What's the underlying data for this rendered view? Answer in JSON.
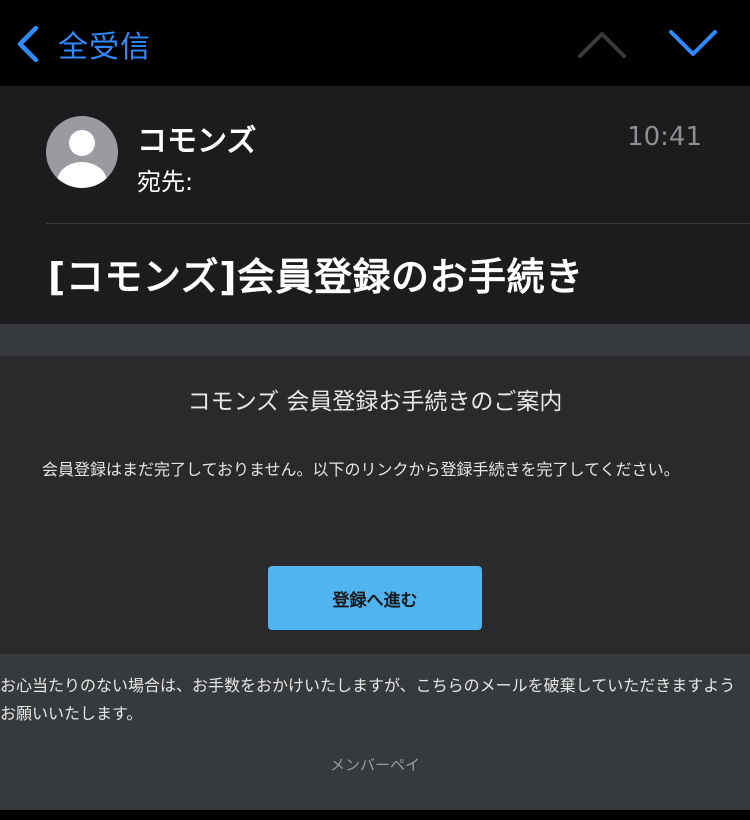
{
  "navbar": {
    "back_label": "全受信",
    "back_icon": "chevron-left-icon",
    "prev_icon": "chevron-up-icon",
    "next_icon": "chevron-down-icon",
    "accent_color": "#2f8cff",
    "disabled_color": "#3a3a3c"
  },
  "header": {
    "sender_name": "コモンズ",
    "recipient_label": "宛先:",
    "time": "10:41",
    "subject": "[コモンズ]会員登録のお手続き",
    "avatar_icon": "person-avatar-icon"
  },
  "message": {
    "card_title": "コモンズ 会員登録お手続きのご案内",
    "card_text": "会員登録はまだ完了しておりません。以下のリンクから登録手続きを完了してください。",
    "cta_label": "登録へ進む",
    "cta_color": "#4fb4f0",
    "footer_text": "お心当たりのない場合は、お手数をおかけいたしますが、こちらのメールを破棄していただきますようお願いいたします。",
    "footer_sign": "メンバーペイ"
  }
}
